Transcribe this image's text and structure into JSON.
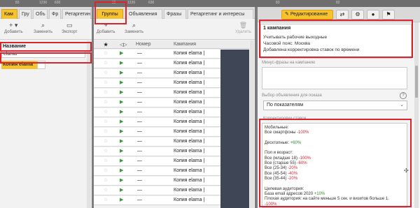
{
  "top_strip": [
    "83",
    "1236",
    "630",
    "82",
    "1236",
    "630",
    "83",
    "82"
  ],
  "left_panel": {
    "tabs": [
      "Кам",
      "Гру",
      "Объ",
      "Фр",
      "Ретаргетинг"
    ],
    "toolbar": {
      "add": "Добавить",
      "replace": "Заменить",
      "export": "Экспорт"
    },
    "column_header": "Название",
    "search_value": "elama",
    "selected_item": "Копия elama"
  },
  "mid_panel": {
    "tabs": [
      "Группы",
      "Объявления",
      "Фразы",
      "Ретаргетинг и интересы"
    ],
    "toolbar": {
      "add": "Добавить",
      "replace": "Заменить",
      "delete": "Удалить"
    },
    "columns": {
      "star": "★",
      "status": "◁▷",
      "number": "Номер",
      "campaign": "Кампания"
    },
    "rows": [
      {
        "star": "☆",
        "number": "—",
        "campaign": "Копия elama |"
      },
      {
        "star": "☆",
        "number": "—",
        "campaign": "Копия elama |"
      },
      {
        "star": "☆",
        "number": "—",
        "campaign": "Копия elama |"
      },
      {
        "star": "☆",
        "number": "—",
        "campaign": "Копия elama |"
      },
      {
        "star": "☆",
        "number": "—",
        "campaign": "Копия elama |"
      },
      {
        "star": "☆",
        "number": "—",
        "campaign": "Копия elama |"
      },
      {
        "star": "☆",
        "number": "—",
        "campaign": "Копия elama |"
      },
      {
        "star": "☆",
        "number": "—",
        "campaign": "Копия elama |"
      },
      {
        "star": "☆",
        "number": "—",
        "campaign": "Копия elama |"
      },
      {
        "star": "☆",
        "number": "—",
        "campaign": "Копия elama |"
      },
      {
        "star": "☆",
        "number": "—",
        "campaign": "Копия elama |"
      },
      {
        "star": "☆",
        "number": "—",
        "campaign": "Копия elama |"
      },
      {
        "star": "☆",
        "number": "—",
        "campaign": "Копия elama |"
      },
      {
        "star": "☆",
        "number": "—",
        "campaign": "Копия elama |"
      },
      {
        "star": "☆",
        "number": "—",
        "campaign": "Копия elama |"
      },
      {
        "star": "☆",
        "number": "—",
        "campaign": "Копия elama |"
      }
    ]
  },
  "right_panel": {
    "edit_button": "Редактирование",
    "campaign_title": "1 кампания",
    "notes": [
      "Учитывать рабочие выходные",
      "Часовой пояс: Москва",
      "Добавлена корректировка ставок по времени"
    ],
    "minus_phrases_label": "Минус-фразы на кампанию",
    "ad_select_label": "Выбор объявления для показа",
    "ad_select_value": "По показателям",
    "adjustments_label": "Корректировки ставок",
    "adjustments": [
      {
        "text": "Мобильные:",
        "value": ""
      },
      {
        "text": "Все смартфоны",
        "value": "-100%"
      },
      {
        "text": "",
        "value": ""
      },
      {
        "text": "Десктопные:",
        "value": "+60%"
      },
      {
        "text": "",
        "value": ""
      },
      {
        "text": "Пол и возраст:",
        "value": ""
      },
      {
        "text": "Все (младше 18)",
        "value": "-100%"
      },
      {
        "text": "Все (старше 55)",
        "value": "-60%"
      },
      {
        "text": "Все (25-34)",
        "value": "-20%"
      },
      {
        "text": "Все (45-54)",
        "value": "-40%"
      },
      {
        "text": "Все (35-44)",
        "value": "-20%"
      },
      {
        "text": "",
        "value": ""
      },
      {
        "text": "Целевая аудитория:",
        "value": ""
      },
      {
        "text": "База email адресов 2020",
        "value": "+10%"
      },
      {
        "text": "Плохая аудитория: на сайте меньше 5 сек. и визитов больше 1.",
        "value": ""
      },
      {
        "text": "",
        "value": "-100%"
      }
    ]
  }
}
